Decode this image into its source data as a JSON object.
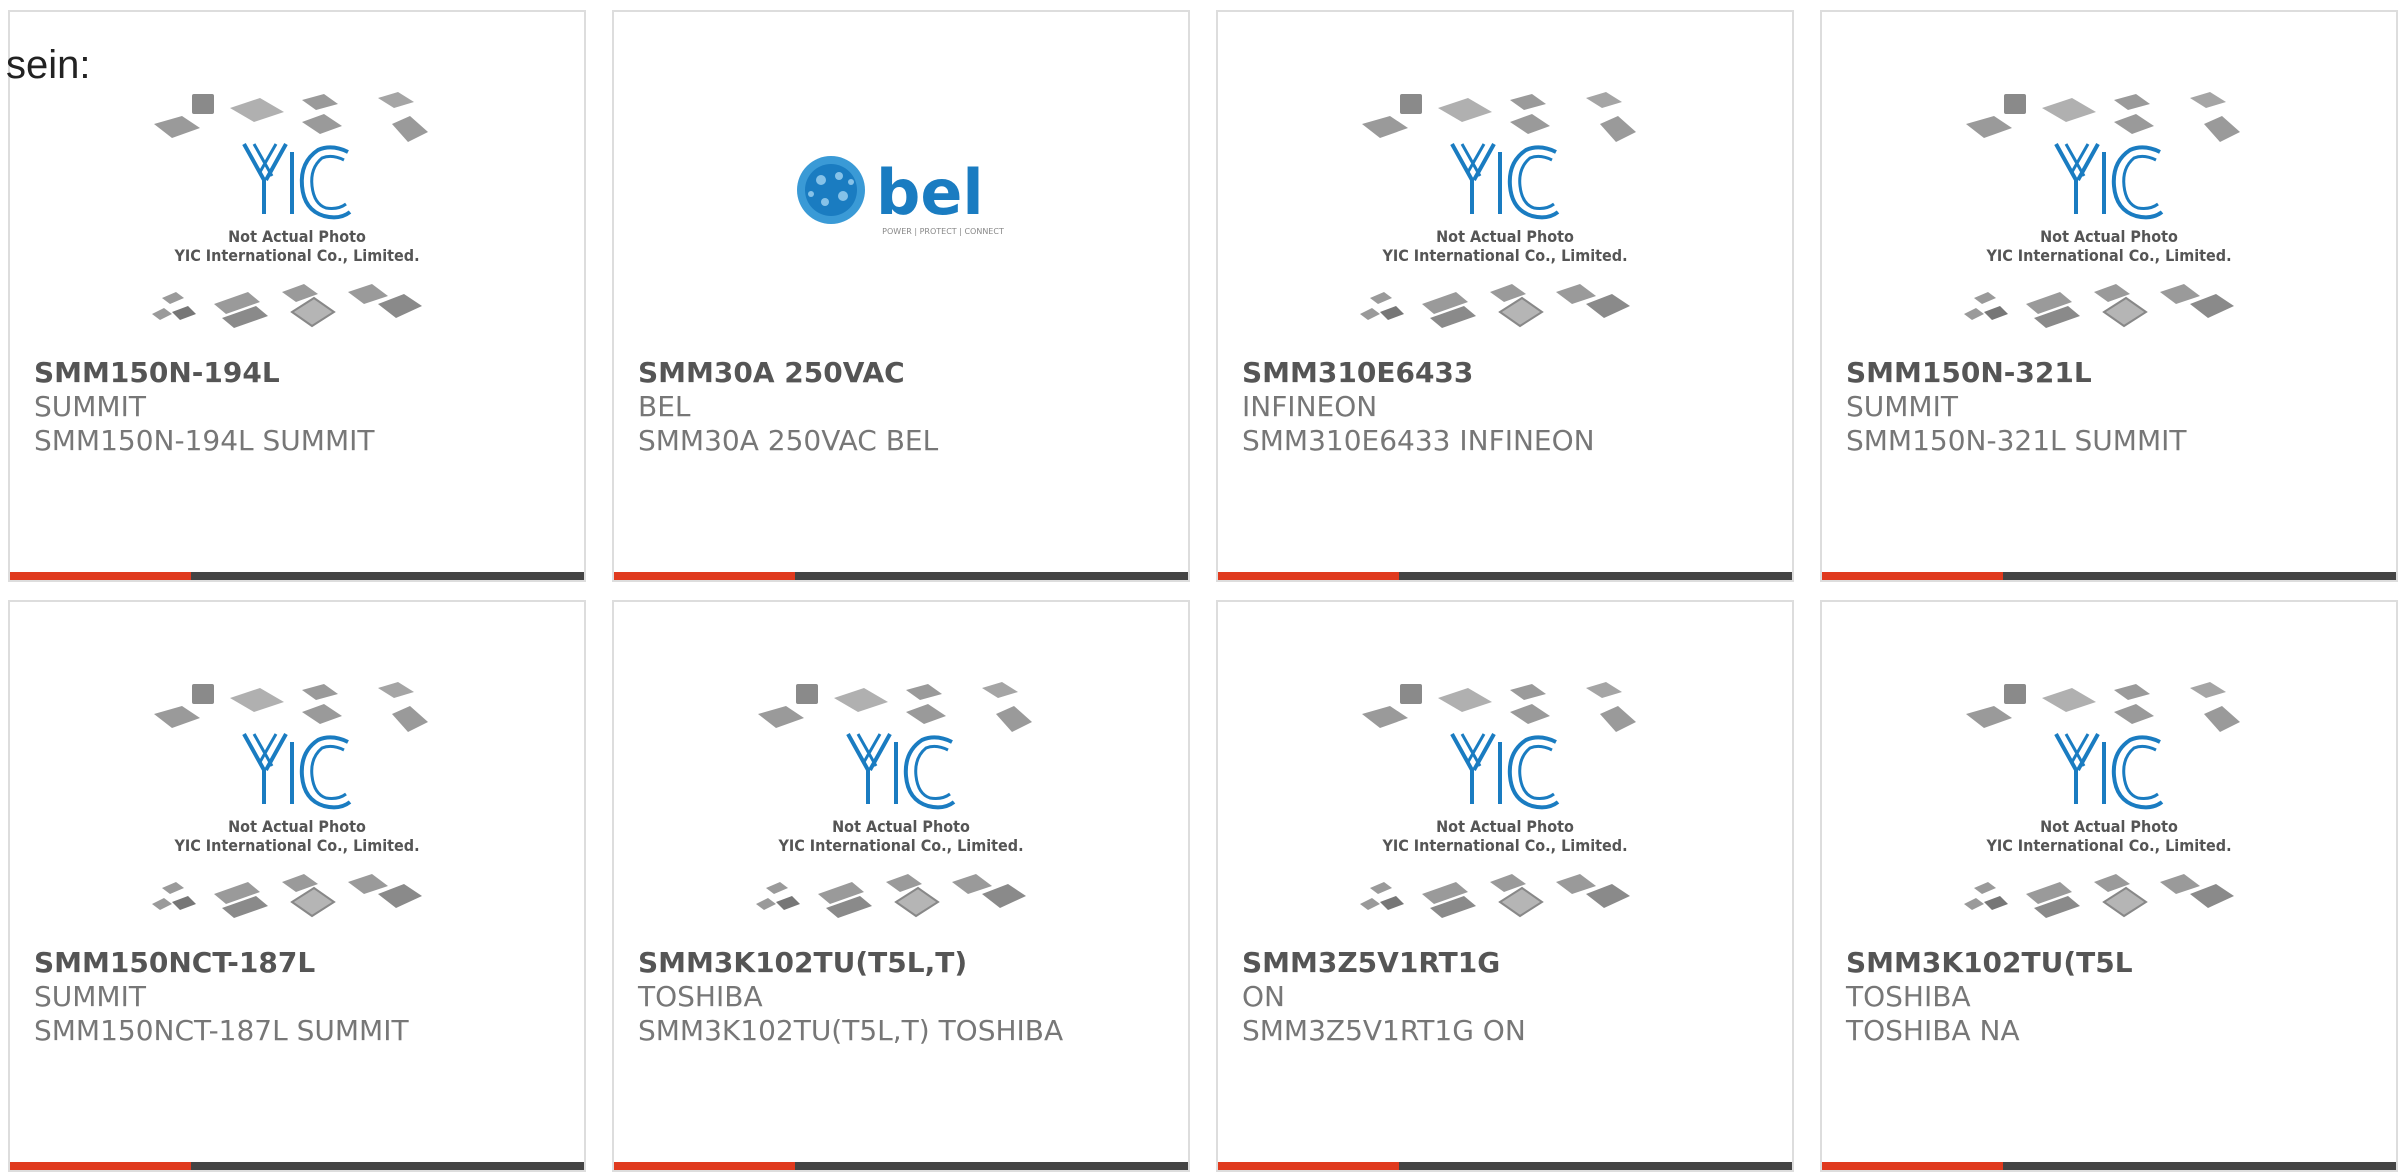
{
  "intro_text": "sein:",
  "colors": {
    "accent_bar": "#e03a1e",
    "dark_bar": "#444444",
    "yic_logo_blue": "#1a7cc1",
    "bel_blue": "#1a7cc1"
  },
  "placeholder": {
    "line1": "Not Actual Photo",
    "line2": "YIC International Co., Limited.",
    "logo_text": "YIC"
  },
  "bel_logo": {
    "wordmark": "bel",
    "tagline": "POWER | PROTECT | CONNECT"
  },
  "products": [
    {
      "part": "SMM150N-194L",
      "manufacturer": "SUMMIT",
      "description": "SMM150N-194L SUMMIT",
      "image": "placeholder"
    },
    {
      "part": "SMM30A 250VAC",
      "manufacturer": "BEL",
      "description": "SMM30A 250VAC BEL",
      "image": "bel-logo"
    },
    {
      "part": "SMM310E6433",
      "manufacturer": "INFINEON",
      "description": "SMM310E6433 INFINEON",
      "image": "placeholder"
    },
    {
      "part": "SMM150N-321L",
      "manufacturer": "SUMMIT",
      "description": "SMM150N-321L SUMMIT",
      "image": "placeholder"
    },
    {
      "part": "SMM150NCT-187L",
      "manufacturer": "SUMMIT",
      "description": "SMM150NCT-187L SUMMIT",
      "image": "placeholder"
    },
    {
      "part": "SMM3K102TU(T5L,T)",
      "manufacturer": "TOSHIBA",
      "description": "SMM3K102TU(T5L,T) TOSHIBA",
      "image": "placeholder"
    },
    {
      "part": "SMM3Z5V1RT1G",
      "manufacturer": "ON",
      "description": "SMM3Z5V1RT1G ON",
      "image": "placeholder"
    },
    {
      "part": "SMM3K102TU(T5L",
      "manufacturer": "TOSHIBA",
      "description": "TOSHIBA NA",
      "image": "placeholder"
    }
  ]
}
